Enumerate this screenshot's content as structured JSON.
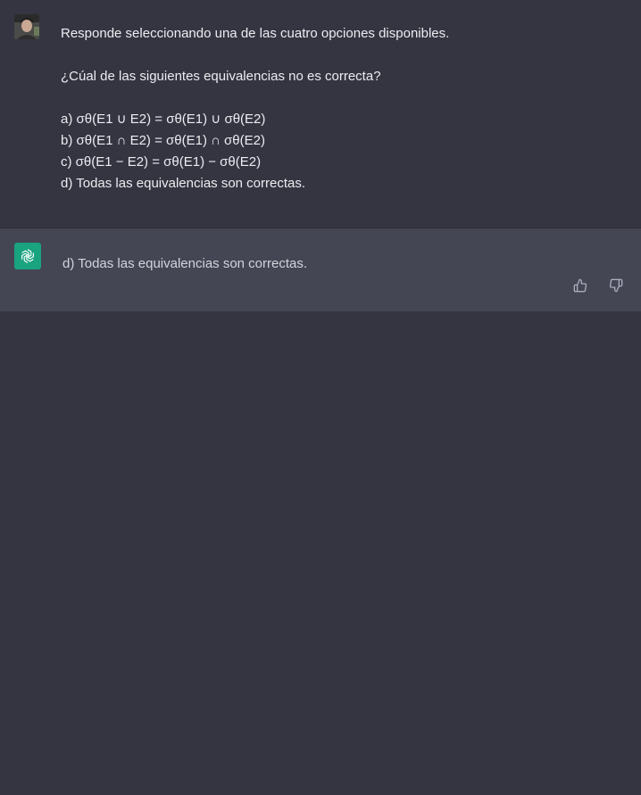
{
  "user_message": {
    "lines": [
      "Responde seleccionando una de las cuatro opciones disponibles.",
      "¿Cúal de las siguientes equivalencias no es correcta?",
      "a) σθ(E1 ∪ E2) = σθ(E1) ∪ σθ(E2)",
      "b) σθ(E1 ∩ E2) = σθ(E1) ∩ σθ(E2)",
      "c) σθ(E1 − E2) = σθ(E1) − σθ(E2)",
      "d) Todas las equivalencias son correctas."
    ]
  },
  "assistant_message": {
    "text": "d) Todas las equivalencias son correctas."
  },
  "icons": {
    "user_avatar": "user-avatar-photo",
    "assistant_avatar": "openai-logo-icon",
    "like": "thumbs-up-icon",
    "dislike": "thumbs-down-icon"
  },
  "colors": {
    "page_background": "#343541",
    "assistant_background": "#444654",
    "assistant_avatar_bg": "#19a37f",
    "text_primary": "#ececf1",
    "text_secondary": "#d1d5db",
    "icon_muted": "#acacbe"
  }
}
